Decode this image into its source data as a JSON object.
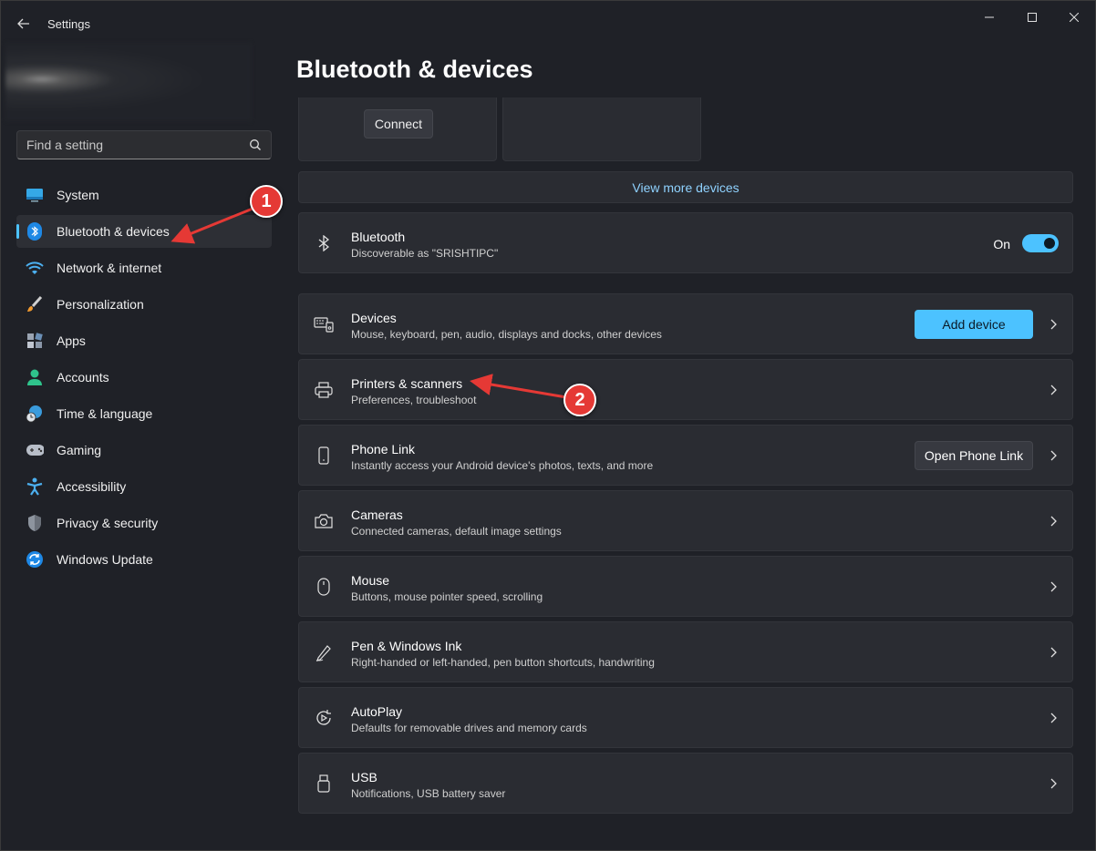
{
  "window": {
    "app_title": "Settings"
  },
  "sidebar": {
    "search_placeholder": "Find a setting",
    "items": [
      {
        "label": "System",
        "icon": "monitor-icon"
      },
      {
        "label": "Bluetooth & devices",
        "icon": "bluetooth-icon",
        "active": true
      },
      {
        "label": "Network & internet",
        "icon": "wifi-icon"
      },
      {
        "label": "Personalization",
        "icon": "brush-icon"
      },
      {
        "label": "Apps",
        "icon": "apps-icon"
      },
      {
        "label": "Accounts",
        "icon": "person-icon"
      },
      {
        "label": "Time & language",
        "icon": "globe-clock-icon"
      },
      {
        "label": "Gaming",
        "icon": "gamepad-icon"
      },
      {
        "label": "Accessibility",
        "icon": "accessibility-icon"
      },
      {
        "label": "Privacy & security",
        "icon": "shield-icon"
      },
      {
        "label": "Windows Update",
        "icon": "update-icon"
      }
    ]
  },
  "main": {
    "page_title": "Bluetooth & devices",
    "connect_label": "Connect",
    "view_more_label": "View more devices",
    "bluetooth": {
      "title": "Bluetooth",
      "subtitle": "Discoverable as \"SRISHTIPC\"",
      "toggle_label": "On",
      "toggle_on": true
    },
    "cards": [
      {
        "title": "Devices",
        "subtitle": "Mouse, keyboard, pen, audio, displays and docks, other devices",
        "button": "Add device",
        "icon": "devices-icon"
      },
      {
        "title": "Printers & scanners",
        "subtitle": "Preferences, troubleshoot",
        "icon": "printer-icon"
      },
      {
        "title": "Phone Link",
        "subtitle": "Instantly access your Android device's photos, texts, and more",
        "button": "Open Phone Link",
        "icon": "phone-icon"
      },
      {
        "title": "Cameras",
        "subtitle": "Connected cameras, default image settings",
        "icon": "camera-icon"
      },
      {
        "title": "Mouse",
        "subtitle": "Buttons, mouse pointer speed, scrolling",
        "icon": "mouse-icon"
      },
      {
        "title": "Pen & Windows Ink",
        "subtitle": "Right-handed or left-handed, pen button shortcuts, handwriting",
        "icon": "pen-icon"
      },
      {
        "title": "AutoPlay",
        "subtitle": "Defaults for removable drives and memory cards",
        "icon": "autoplay-icon"
      },
      {
        "title": "USB",
        "subtitle": "Notifications, USB battery saver",
        "icon": "usb-icon"
      }
    ]
  },
  "annotations": {
    "step1": "1",
    "step2": "2",
    "color": "#e53935"
  },
  "colors": {
    "accent": "#4cc2ff",
    "background": "#1f2127",
    "card": "#2a2c32"
  }
}
